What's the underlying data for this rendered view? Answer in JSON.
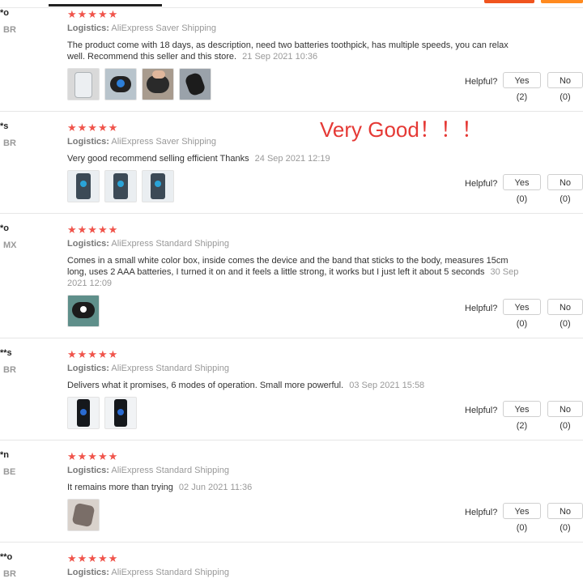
{
  "annotation": "Very Good！！！",
  "helpful_label": "Helpful?",
  "logistics_label": "Logistics:",
  "reviews": [
    {
      "user": "*o",
      "country": "BR",
      "stars": "★★★★★",
      "shipping": "AliExpress Saver Shipping",
      "text": "The product come with 18 days, as description, need two batteries toothpick, has multiple speeds, you can relax well. Recommend this seller and this store.",
      "date": "21 Sep 2021 10:36",
      "photos": [
        "remote-photo",
        "pad-photo",
        "hand-photo",
        "dark-photo"
      ],
      "yes": "Yes (2)",
      "no": "No (0)"
    },
    {
      "user": "*s",
      "country": "BR",
      "stars": "★★★★★",
      "shipping": "AliExpress Saver Shipping",
      "text": "Very good recommend selling efficient Thanks",
      "date": "24 Sep 2021 12:19",
      "photos": [
        "box-photo",
        "box-photo",
        "box-photo"
      ],
      "yes": "Yes (0)",
      "no": "No (0)"
    },
    {
      "user": "*o",
      "country": "MX",
      "stars": "★★★★★",
      "shipping": "AliExpress Standard Shipping",
      "text": "Comes in a small white color box, inside comes the device and the band that sticks to the body, measures 15cm long, uses 2 AAA batteries, I turned it on and it feels a little strong, it works but I just left it about 5 seconds",
      "date": "30 Sep 2021 12:09",
      "photos": [
        "body-photo"
      ],
      "yes": "Yes (0)",
      "no": "No (0)"
    },
    {
      "user": "**s",
      "country": "BR",
      "stars": "★★★★★",
      "shipping": "AliExpress Standard Shipping",
      "text": "Delivers what it promises, 6 modes of operation. Small more powerful.",
      "date": "03 Sep 2021 15:58",
      "photos": [
        "phone-photo",
        "phone-photo"
      ],
      "yes": "Yes (2)",
      "no": "No (0)"
    },
    {
      "user": "*n",
      "country": "BE",
      "stars": "★★★★★",
      "shipping": "AliExpress Standard Shipping",
      "text": "It remains more than trying",
      "date": "02 Jun 2021 11:36",
      "photos": [
        "silver-photo"
      ],
      "yes": "Yes (0)",
      "no": "No (0)"
    },
    {
      "user": "**o",
      "country": "BR",
      "stars": "★★★★★",
      "shipping": "AliExpress Standard Shipping"
    }
  ]
}
